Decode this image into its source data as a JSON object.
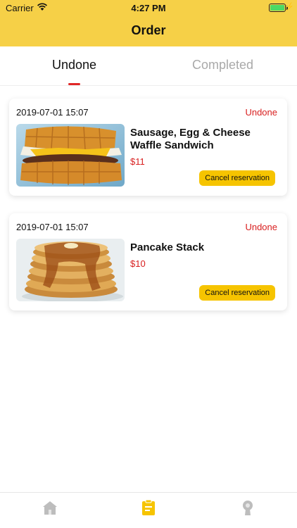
{
  "status_bar": {
    "carrier": "Carrier",
    "time": "4:27 PM"
  },
  "header": {
    "title": "Order",
    "background": "#f6d047"
  },
  "tabs": [
    {
      "label": "Undone",
      "active": true
    },
    {
      "label": "Completed",
      "active": false
    }
  ],
  "orders": [
    {
      "date": "2019-07-01 15:07",
      "status": "Undone",
      "name": "Sausage, Egg & Cheese Waffle Sandwich",
      "price": "$11",
      "action": "Cancel reservation",
      "image_icon": "waffle-sandwich-image"
    },
    {
      "date": "2019-07-01 15:07",
      "status": "Undone",
      "name": "Pancake Stack",
      "price": "$10",
      "action": "Cancel reservation",
      "image_icon": "pancake-stack-image"
    }
  ],
  "bottom_nav": [
    {
      "icon": "home-icon",
      "active": false
    },
    {
      "icon": "orders-icon",
      "active": true
    },
    {
      "icon": "profile-icon",
      "active": false
    }
  ],
  "colors": {
    "accent": "#f6c400",
    "status_red": "#d81e1e"
  }
}
